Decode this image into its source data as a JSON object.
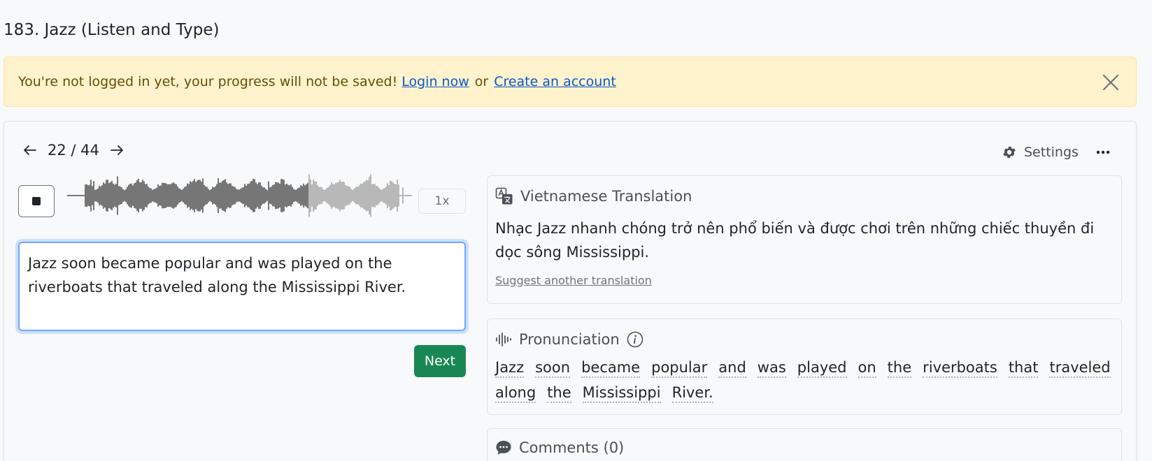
{
  "page": {
    "title": "183. Jazz (Listen and Type)"
  },
  "alert": {
    "message": "You're not logged in yet, your progress will not be saved!",
    "login_link": "Login now",
    "or_text": "or",
    "signup_link": "Create an account",
    "close_icon": "close-icon"
  },
  "pager": {
    "prev_icon": "arrow-left-icon",
    "count": "22 / 44",
    "next_icon": "arrow-right-icon"
  },
  "toolbar": {
    "settings_label": "Settings",
    "settings_icon": "gear-icon",
    "more_icon": "ellipsis-icon"
  },
  "player": {
    "stop_icon": "stop-icon",
    "progress": 0.7,
    "speed": "1x"
  },
  "answer": {
    "value": "Jazz soon became popular and was played on the riverboats that traveled along the Mississippi River."
  },
  "next_button": {
    "label": "Next",
    "color": "#198754"
  },
  "translation": {
    "heading": "Vietnamese Translation",
    "icon": "translate-icon",
    "text": "Nhạc Jazz nhanh chóng trở nên phổ biến và được chơi trên những chiếc thuyền đi dọc sông Mississippi.",
    "suggest_link": "Suggest another translation"
  },
  "pronunciation": {
    "heading": "Pronunciation",
    "icon": "audio-wave-icon",
    "info_icon": "info-icon",
    "words": [
      "Jazz",
      "soon",
      "became",
      "popular",
      "and",
      "was",
      "played",
      "on",
      "the",
      "riverboats",
      "that",
      "traveled",
      "along",
      "the",
      "Mississippi",
      "River."
    ]
  },
  "comments": {
    "heading": "Comments (0)",
    "icon": "chat-icon"
  }
}
